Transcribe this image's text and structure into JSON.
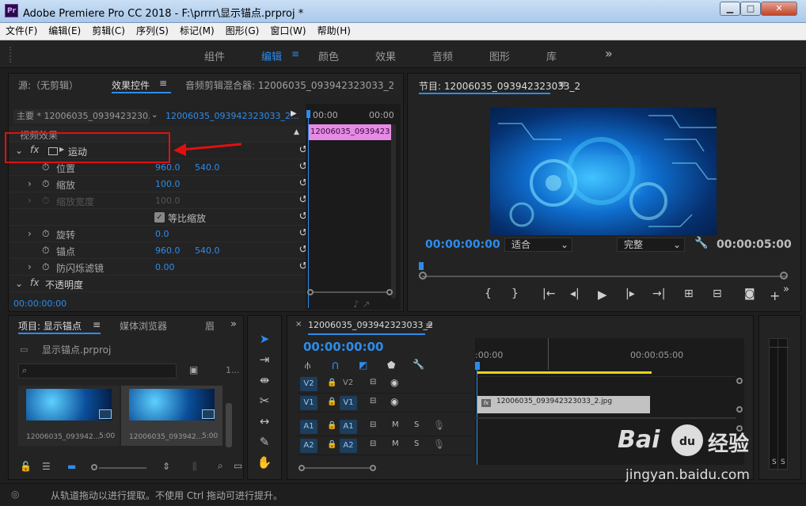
{
  "window": {
    "app_icon": "Pr",
    "title": "Adobe Premiere Pro CC 2018 - F:\\prrrr\\显示锚点.prproj *"
  },
  "menu": [
    "文件(F)",
    "编辑(E)",
    "剪辑(C)",
    "序列(S)",
    "标记(M)",
    "图形(G)",
    "窗口(W)",
    "帮助(H)"
  ],
  "workspaces": [
    "组件",
    "编辑",
    "颜色",
    "效果",
    "音频",
    "图形",
    "库"
  ],
  "workspace_more": "»",
  "effect_panel": {
    "tab_source": "源:（无剪辑）",
    "tab_effects": "效果控件",
    "tab_mixer": "音频剪辑混合器: 12006035_093942323033_2",
    "master": "主要 * 12006035_0939423230...",
    "clip": "12006035_093942323033_2...",
    "time_start": "00:00",
    "time_end": "00:00",
    "clip_bar": "12006035_0939423",
    "section_video": "视频效果",
    "fx": "fx",
    "motion": "运动",
    "pos_label": "位置",
    "pos_x": "960.0",
    "pos_y": "540.0",
    "scale_label": "缩放",
    "scale_val": "100.0",
    "scalew_label": "缩放宽度",
    "scalew_val": "100.0",
    "uniform_label": "等比缩放",
    "rot_label": "旋转",
    "rot_val": "0.0",
    "anchor_label": "锚点",
    "anchor_x": "960.0",
    "anchor_y": "540.0",
    "flicker_label": "防闪烁滤镜",
    "flicker_val": "0.00",
    "opacity_label": "不透明度",
    "timecode": "00:00:00:00"
  },
  "program": {
    "title": "节目: 12006035_093942323033_2",
    "timecode": "00:00:00:00",
    "fit": "适合",
    "quality": "完整",
    "duration": "00:00:05:00"
  },
  "project": {
    "tab_project": "项目: 显示锚点",
    "tab_media": "媒体浏览器",
    "tab_lib": "眉",
    "file": "显示锚点.prproj",
    "count": "1...",
    "items": [
      {
        "name": "12006035_093942...",
        "dur": "5:00"
      },
      {
        "name": "12006035_093942...",
        "dur": "5:00"
      }
    ]
  },
  "timeline": {
    "tab": "12006035_093942323033_2",
    "timecode": "00:00:00:00",
    "ruler_start": ":00:00",
    "ruler_mid": "00:00:05:00",
    "clip_name": "12006035_093942323033_2.jpg",
    "tracks": [
      {
        "a": "V2",
        "b": "V2"
      },
      {
        "a": "V1",
        "b": "V1"
      },
      {
        "a": "A1",
        "b": "A1"
      },
      {
        "a": "A2",
        "b": "A2"
      }
    ],
    "mute": "M",
    "solo": "S"
  },
  "meter": {
    "s1": "S",
    "s2": "S"
  },
  "status": "从轨道拖动以进行提取。不使用 Ctrl 拖动可进行提升。",
  "watermark": {
    "brand": "Bai",
    "paw": "du",
    "cn": "经验",
    "url": "jingyan.baidu.com"
  },
  "colors": {
    "accent": "#2d8ceb",
    "annotation": "#e01010",
    "clip_pink": "#e58ae5"
  }
}
